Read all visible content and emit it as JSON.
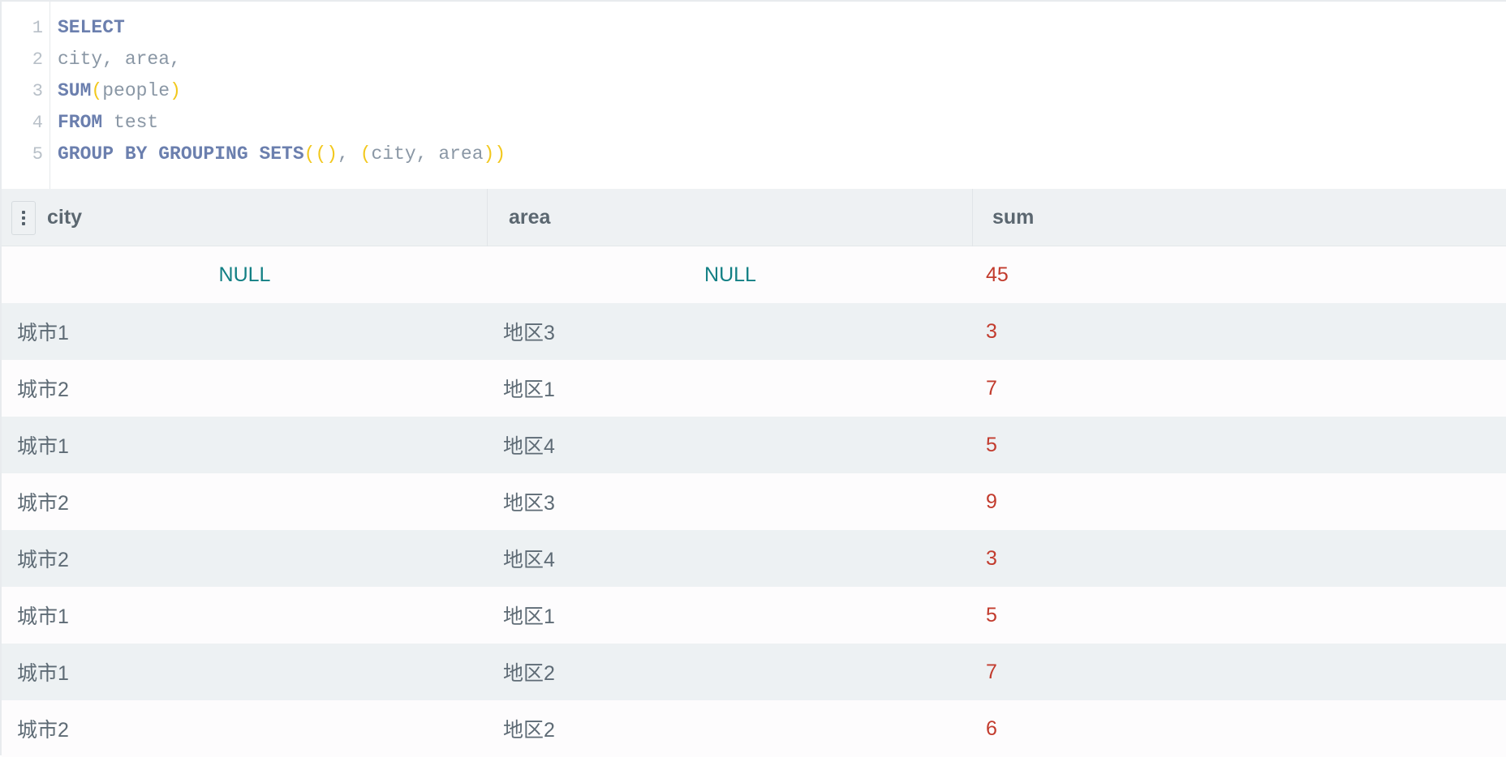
{
  "editor": {
    "line_numbers": [
      "1",
      "2",
      "3",
      "4",
      "5"
    ],
    "lines": [
      [
        {
          "t": "SELECT",
          "k": "kw"
        }
      ],
      [
        {
          "t": "city, area,",
          "k": "ident"
        }
      ],
      [
        {
          "t": "SUM",
          "k": "kw"
        },
        {
          "t": "(",
          "k": "paren"
        },
        {
          "t": "people",
          "k": "ident"
        },
        {
          "t": ")",
          "k": "paren"
        }
      ],
      [
        {
          "t": "FROM",
          "k": "kw"
        },
        {
          "t": " test",
          "k": "ident"
        }
      ],
      [
        {
          "t": "GROUP BY GROUPING SETS",
          "k": "kw"
        },
        {
          "t": "(()",
          "k": "paren"
        },
        {
          "t": ", ",
          "k": "ident"
        },
        {
          "t": "(",
          "k": "paren"
        },
        {
          "t": "city, area",
          "k": "ident"
        },
        {
          "t": "))",
          "k": "paren"
        }
      ]
    ]
  },
  "results": {
    "columns": [
      "city",
      "area",
      "sum"
    ],
    "rows": [
      [
        "NULL",
        "NULL",
        "45"
      ],
      [
        "城市1",
        "地区3",
        "3"
      ],
      [
        "城市2",
        "地区1",
        "7"
      ],
      [
        "城市1",
        "地区4",
        "5"
      ],
      [
        "城市2",
        "地区3",
        "9"
      ],
      [
        "城市2",
        "地区4",
        "3"
      ],
      [
        "城市1",
        "地区1",
        "5"
      ],
      [
        "城市1",
        "地区2",
        "7"
      ],
      [
        "城市2",
        "地区2",
        "6"
      ]
    ]
  },
  "colors": {
    "keyword": "#6b7fae",
    "paren": "#f2c81e",
    "identifier": "#8a97a5",
    "null_value": "#127f84",
    "number_value": "#c23b2d"
  },
  "icons": {
    "column_menu": "vertical-dots-icon"
  }
}
